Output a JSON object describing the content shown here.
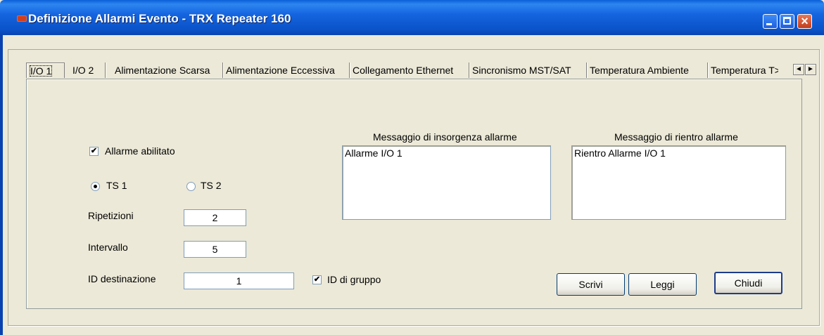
{
  "window": {
    "title": "Definizione Allarmi Evento - TRX Repeater 160",
    "icon": "app-icon",
    "controls": [
      "minimize-icon",
      "maximize-icon",
      "close-icon"
    ]
  },
  "tabs": [
    {
      "label": "I/O 1",
      "active": true
    },
    {
      "label": "I/O 2"
    },
    {
      "label": "Alimentazione Scarsa"
    },
    {
      "label": "Alimentazione Eccessiva"
    },
    {
      "label": "Collegamento Ethernet"
    },
    {
      "label": "Sincronismo MST/SAT"
    },
    {
      "label": "Temperatura Ambiente"
    },
    {
      "label": "Temperatura T>"
    }
  ],
  "tab_scroll": {
    "left": "◄",
    "right": "►"
  },
  "form": {
    "alarm_enabled": {
      "label": "Allarme abilitato",
      "checked": true,
      "mark": "✔"
    },
    "ts1": {
      "label": "TS 1",
      "checked": true
    },
    "ts2": {
      "label": "TS 2",
      "checked": false
    },
    "repetitions": {
      "label": "Ripetizioni",
      "value": "2"
    },
    "interval": {
      "label": "Intervallo",
      "value": "5"
    },
    "destination": {
      "label": "ID destinazione",
      "value": "1"
    },
    "group_id": {
      "label": "ID di gruppo",
      "checked": true,
      "mark": "✔"
    }
  },
  "messages": {
    "onset": {
      "label": "Messaggio di insorgenza allarme",
      "value": "Allarme I/O 1"
    },
    "return": {
      "label": "Messaggio di rientro allarme",
      "value": "Rientro Allarme I/O 1"
    }
  },
  "buttons": {
    "write": "Scrivi",
    "read": "Leggi",
    "close": "Chiudi"
  }
}
